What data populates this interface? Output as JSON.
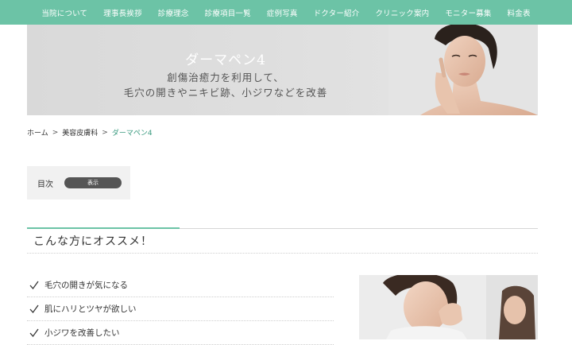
{
  "nav": {
    "items": [
      "当院について",
      "理事長挨拶",
      "診療理念",
      "診療項目一覧",
      "症例写真",
      "ドクター紹介",
      "クリニック案内",
      "モニター募集",
      "料金表"
    ],
    "background": "#6cc3a6"
  },
  "hero": {
    "title": "ダーマペン4",
    "subtitle_line1": "創傷治癒力を利用して、",
    "subtitle_line2": "毛穴の開きやニキビ跡、小ジワなどを改善"
  },
  "breadcrumb": {
    "home": "ホーム",
    "category": "美容皮膚科",
    "current": "ダーマペン4",
    "separator": ">"
  },
  "toc": {
    "label": "目次",
    "button_label": "表示"
  },
  "section": {
    "title": "こんな方にオススメ！",
    "items": [
      "毛穴の開きが気になる",
      "肌にハリとツヤが欲しい",
      "小ジワを改善したい"
    ]
  },
  "colors": {
    "accent": "#6cc3a6",
    "link": "#3a9a7f"
  }
}
